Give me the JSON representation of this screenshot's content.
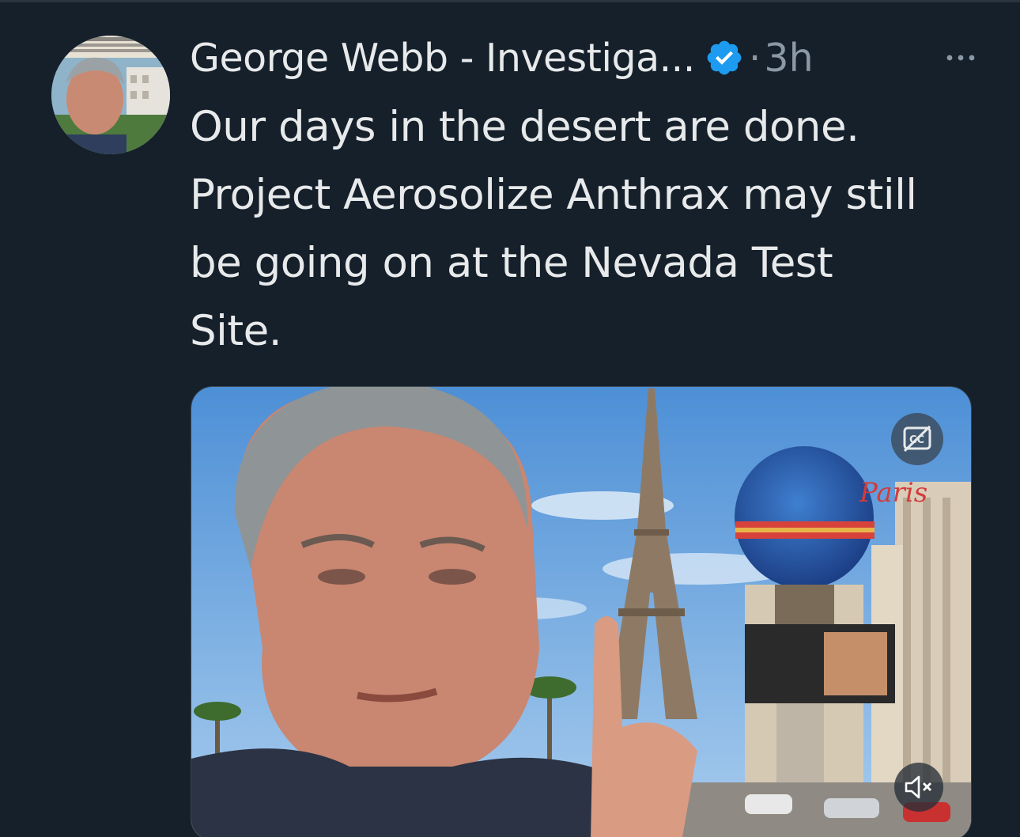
{
  "tweet": {
    "author": {
      "display_name": "George Webb - Investiga...",
      "verified": true,
      "verified_color": "#1d9bf0",
      "avatar_icon": "profile-photo"
    },
    "separator": "·",
    "timestamp": "3h",
    "more_icon": "ellipsis-icon",
    "text_lines": [
      "Our days in the desert are done.",
      "Project Aerosolize Anthrax may still",
      "be going on at the Nevada Test",
      "Site."
    ],
    "media": {
      "type": "video",
      "captions_icon": "captions-off-icon",
      "mute_icon": "muted-speaker-icon"
    }
  },
  "colors": {
    "background": "#15202b",
    "primary_text": "#e7e9ea",
    "secondary_text": "#8b98a5",
    "accent": "#1d9bf0"
  }
}
